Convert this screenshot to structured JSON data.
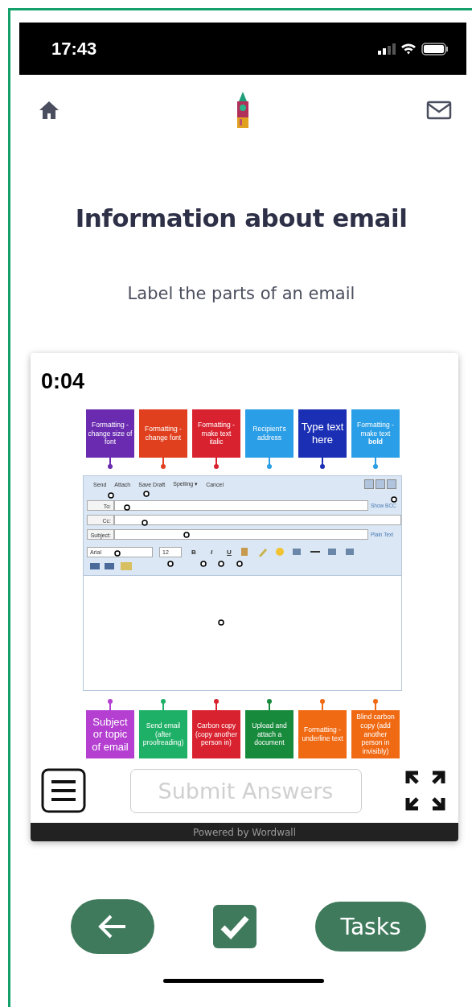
{
  "status_bar": {
    "time": "17:43"
  },
  "title": "Information about email",
  "subtitle": "Label the parts of an email",
  "activity": {
    "timer": "0:04",
    "top_labels": [
      {
        "text": "Formatting - change size of font",
        "color": "#6a2bb0",
        "large": false
      },
      {
        "text": "Formatting - change font",
        "color": "#e0401e",
        "large": false
      },
      {
        "text": "Formatting - make text italic",
        "color": "#d9222f",
        "large": false
      },
      {
        "text": "Recipient's address",
        "color": "#2a9ee6",
        "large": false
      },
      {
        "text": "Type text here",
        "color": "#1b2fb5",
        "large": true
      },
      {
        "text": "Formatting - make text **bold**",
        "color": "#2a9ee6",
        "large": false
      }
    ],
    "email": {
      "toolbar": [
        "Send",
        "Attach",
        "Save Draft",
        "Spelling ▾",
        "Cancel"
      ],
      "fields": [
        {
          "label": "To:",
          "link": "Show BCC"
        },
        {
          "label": "Cc:"
        },
        {
          "label": "Subject:",
          "link": "Plain Text"
        }
      ],
      "font": "Arial",
      "size": "12",
      "format_buttons": [
        "B",
        "I",
        "U"
      ]
    },
    "bottom_labels": [
      {
        "text": "Subject or topic of email",
        "color": "#b43fd1",
        "large": true
      },
      {
        "text": "Send email (after proofreading)",
        "color": "#1eb066",
        "large": false
      },
      {
        "text": "Carbon copy (copy another person in)",
        "color": "#d9222f",
        "large": false
      },
      {
        "text": "Upload and attach a document",
        "color": "#178a3c",
        "large": false
      },
      {
        "text": "Formatting - underline text",
        "color": "#f06a14",
        "large": false
      },
      {
        "text": "Blind carbon copy (add another person in invisibly)",
        "color": "#f06a14",
        "large": false
      }
    ],
    "submit": {
      "label": "Submit Answers",
      "disabled": true
    },
    "footer": "Powered by Wordwall"
  },
  "nav": {
    "tasks": "Tasks"
  }
}
